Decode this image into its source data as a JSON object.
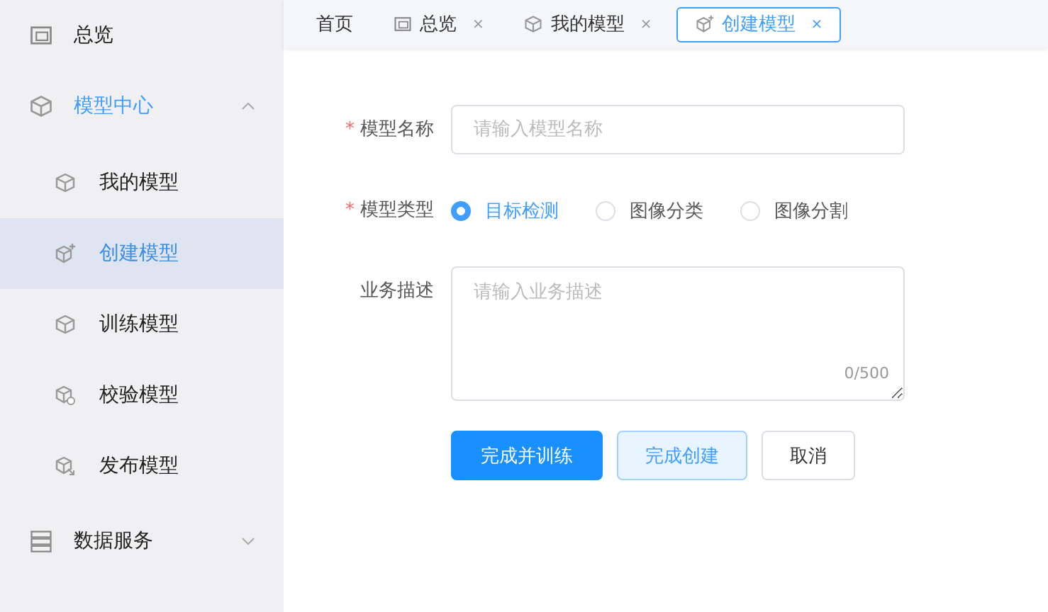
{
  "sidebar": {
    "items": [
      {
        "label": "总览",
        "selected": false
      },
      {
        "label": "模型中心",
        "selected": false,
        "expanded": true,
        "children": [
          {
            "label": "我的模型",
            "selected": false
          },
          {
            "label": "创建模型",
            "selected": true
          },
          {
            "label": "训练模型",
            "selected": false
          },
          {
            "label": "校验模型",
            "selected": false
          },
          {
            "label": "发布模型",
            "selected": false
          }
        ]
      },
      {
        "label": "数据服务",
        "selected": false,
        "expanded": false
      }
    ]
  },
  "tabs": [
    {
      "label": "首页",
      "selected": false,
      "closable": false
    },
    {
      "label": "总览",
      "selected": false,
      "closable": true,
      "close": "×"
    },
    {
      "label": "我的模型",
      "selected": false,
      "closable": true,
      "close": "×"
    },
    {
      "label": "创建模型",
      "selected": true,
      "closable": true,
      "close": "×"
    }
  ],
  "form": {
    "fields": [
      {
        "kind": "input",
        "label": "模型名称",
        "required": true,
        "placeholder": "请输入模型名称"
      },
      {
        "kind": "radio",
        "label": "模型类型",
        "required": true,
        "options": [
          {
            "label": "目标检测",
            "selected": true
          },
          {
            "label": "图像分类",
            "selected": false
          },
          {
            "label": "图像分割",
            "selected": false
          }
        ]
      },
      {
        "kind": "textarea",
        "label": "业务描述",
        "required": false,
        "placeholder": "请输入业务描述",
        "counter": "0/500"
      }
    ],
    "required_mark": "*",
    "buttons": [
      {
        "label": "完成并训练",
        "kind": "primary"
      },
      {
        "label": "完成创建",
        "kind": "plain"
      },
      {
        "label": "取消",
        "kind": "default"
      }
    ]
  }
}
